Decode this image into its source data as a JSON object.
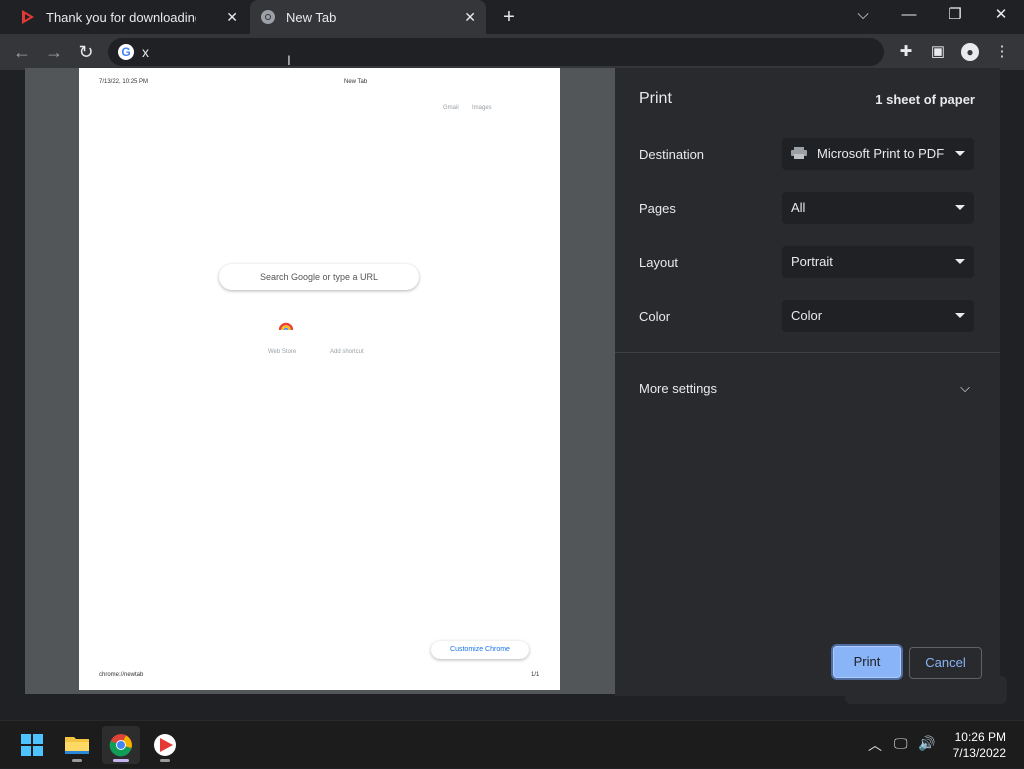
{
  "browser": {
    "tabs": [
      {
        "title": "Thank you for downloading Vidd",
        "active": false
      },
      {
        "title": "New Tab",
        "active": true
      }
    ],
    "new_tab": "+",
    "omnibox": {
      "text": "x"
    }
  },
  "preview": {
    "header_date": "7/13/22, 10:25 PM",
    "header_title": "New Tab",
    "gmail": "Gmail",
    "images": "Images",
    "search_placeholder": "Search Google or type a URL",
    "shortcut_webstore": "Web Store",
    "shortcut_add": "Add shortcut",
    "customize": "Customize Chrome",
    "footer_url": "chrome://newtab",
    "footer_page": "1/1"
  },
  "print": {
    "title": "Print",
    "sheets": "1 sheet of paper",
    "settings": [
      {
        "label": "Destination",
        "value": "Microsoft Print to PDF"
      },
      {
        "label": "Pages",
        "value": "All"
      },
      {
        "label": "Layout",
        "value": "Portrait"
      },
      {
        "label": "Color",
        "value": "Color"
      }
    ],
    "more_settings": "More settings",
    "print_button": "Print",
    "cancel_button": "Cancel"
  },
  "taskbar": {
    "time": "10:26 PM",
    "date": "7/13/2022",
    "apps": [
      "windows-start",
      "file-explorer",
      "chrome",
      "viddly"
    ]
  },
  "colors": {
    "panel_bg": "#292a2d",
    "accent": "#8ab4f8",
    "tab_active_bg": "#35363a"
  }
}
